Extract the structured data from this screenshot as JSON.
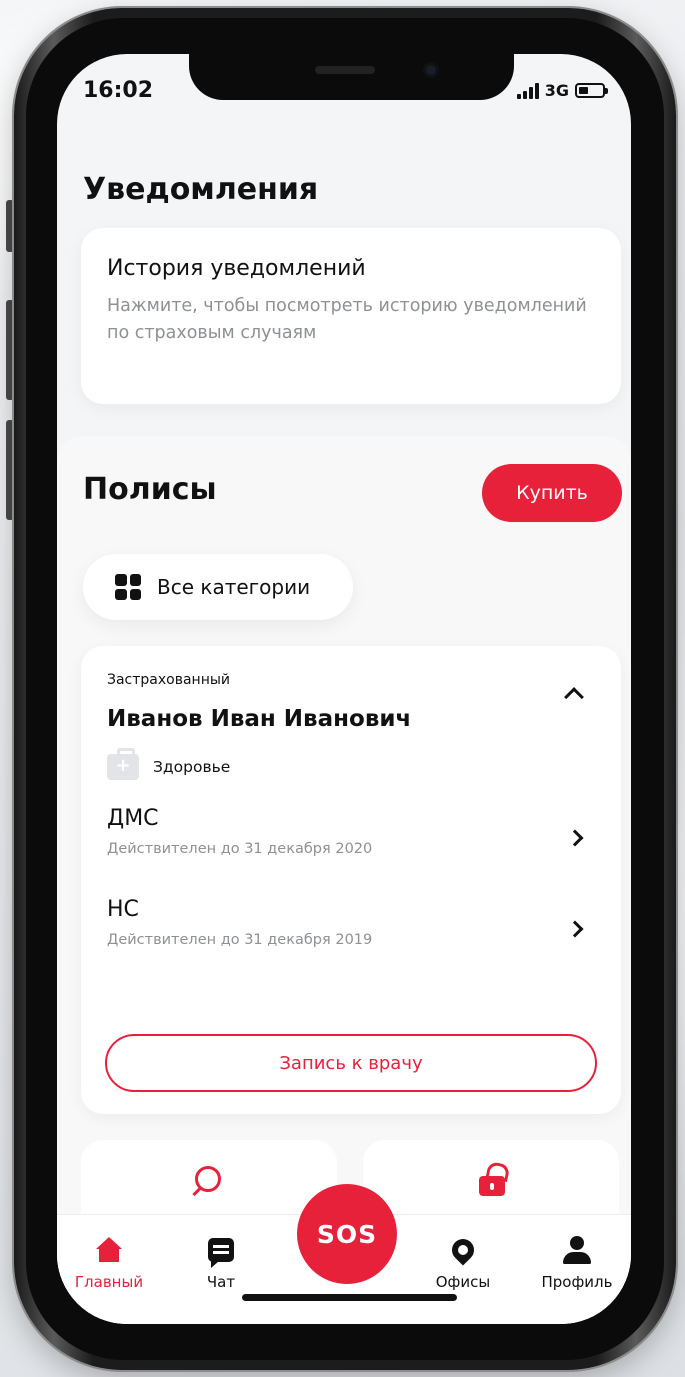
{
  "status_bar": {
    "time": "16:02",
    "network": "3G"
  },
  "notifications": {
    "heading": "Уведомления",
    "card_title": "История уведомлений",
    "card_subtitle": "Нажмите, чтобы посмотреть историю уведомлений по страховым случаям"
  },
  "policies": {
    "heading": "Полисы",
    "buy_label": "Купить",
    "category_filter": "Все категории",
    "insured_label": "Застрахованный",
    "insured_name": "Иванов Иван Иванович",
    "category": "Здоровье",
    "items": [
      {
        "name": "ДМС",
        "valid": "Действителен до 31 декабря 2020"
      },
      {
        "name": "НС",
        "valid": "Действителен до 31 декабря 2019"
      }
    ],
    "doctor_button": "Запись к врачу"
  },
  "tabbar": {
    "tabs": [
      {
        "label": "Главный",
        "icon": "home-icon",
        "active": true
      },
      {
        "label": "Чат",
        "icon": "chat-icon",
        "active": false
      },
      {
        "label": "Офисы",
        "icon": "pin-icon",
        "active": false
      },
      {
        "label": "Профиль",
        "icon": "user-icon",
        "active": false
      }
    ],
    "sos_label": "SOS"
  },
  "colors": {
    "accent": "#e8213a",
    "text": "#111111",
    "muted": "#8e9094",
    "background": "#f4f5f7"
  }
}
